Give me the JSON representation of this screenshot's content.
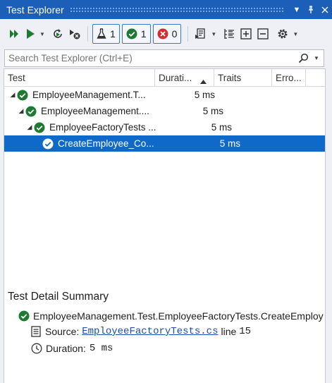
{
  "window": {
    "title": "Test Explorer"
  },
  "toolbar": {
    "total_count": "1",
    "passed_count": "1",
    "failed_count": "0"
  },
  "search": {
    "placeholder": "Search Test Explorer (Ctrl+E)"
  },
  "grid": {
    "columns": [
      {
        "label": "Test"
      },
      {
        "label": "Durati..."
      },
      {
        "label": "Traits"
      },
      {
        "label": "Erro..."
      }
    ],
    "sorted_column": "Durati...",
    "rows": [
      {
        "name": "EmployeeManagement.T...",
        "duration": "5 ms",
        "level": 0,
        "status": "passed",
        "selected": false
      },
      {
        "name": "EmployeeManagement....",
        "duration": "5 ms",
        "level": 1,
        "status": "passed",
        "selected": false
      },
      {
        "name": "EmployeeFactoryTests ...",
        "duration": "5 ms",
        "level": 2,
        "status": "passed",
        "selected": false
      },
      {
        "name": "CreateEmployee_Co...",
        "duration": "5 ms",
        "level": 3,
        "status": "passed",
        "selected": true
      }
    ]
  },
  "summary": {
    "title": "Test Detail Summary",
    "test_full_name": "EmployeeManagement.Test.EmployeeFactoryTests.CreateEmploy",
    "source_label": "Source:",
    "source_file": "EmployeeFactoryTests.cs",
    "source_line_label": "line",
    "source_line": "15",
    "duration_label": "Duration:",
    "duration_value": "5 ms"
  },
  "colors": {
    "titlebar": "#1b5fb8",
    "selection": "#0f69c9",
    "passed": "#1e7a32",
    "failed": "#d32f2f",
    "link": "#1a4fa8"
  }
}
